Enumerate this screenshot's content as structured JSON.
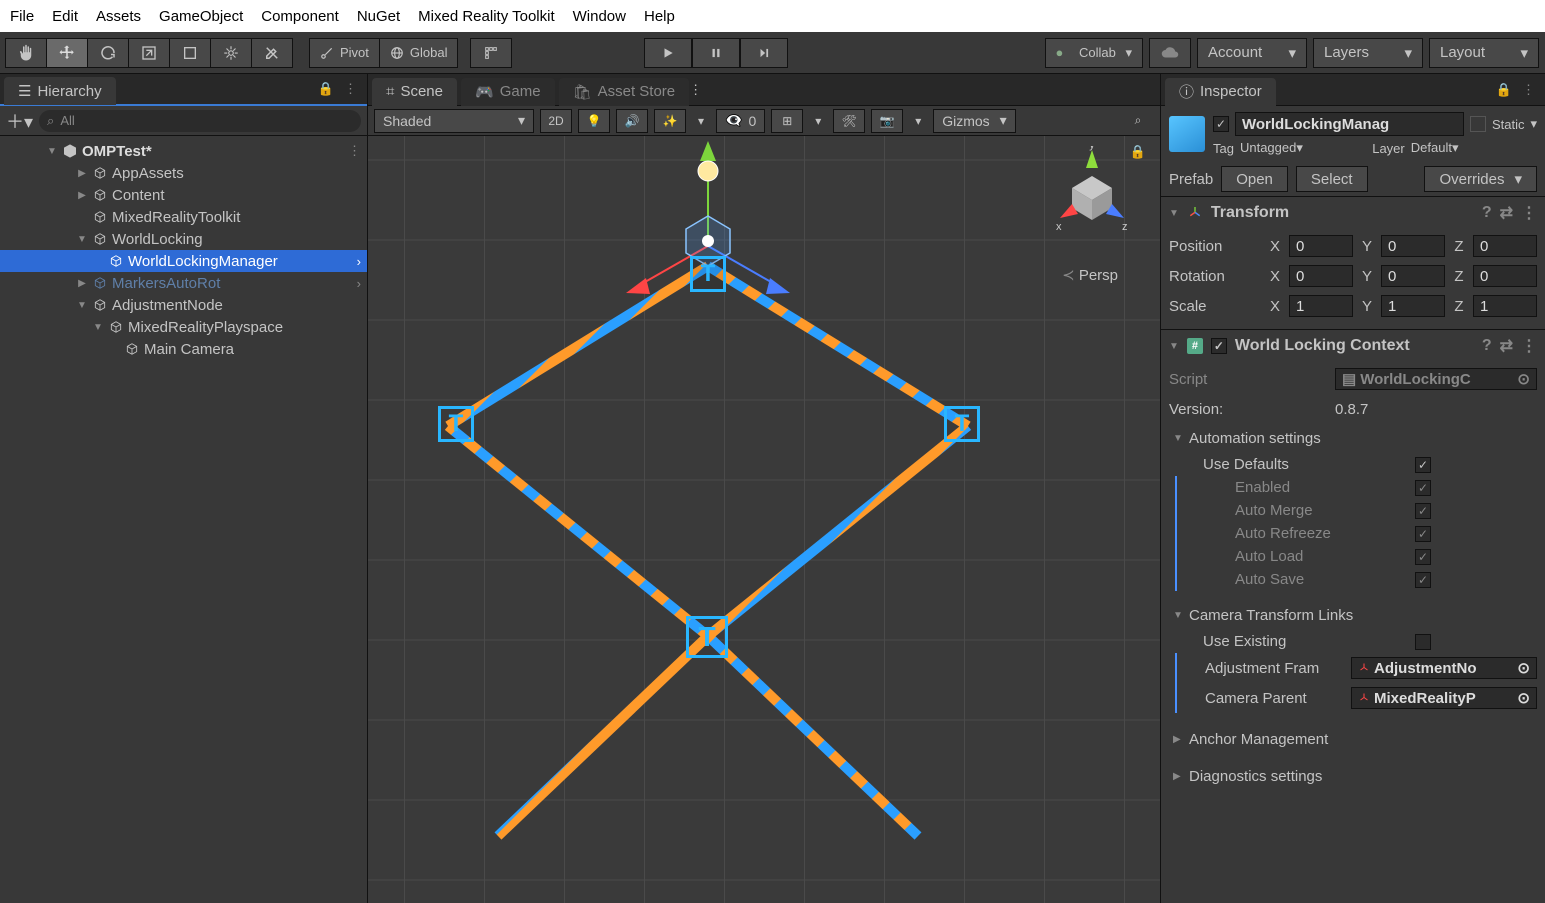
{
  "menubar": [
    "File",
    "Edit",
    "Assets",
    "GameObject",
    "Component",
    "NuGet",
    "Mixed Reality Toolkit",
    "Window",
    "Help"
  ],
  "toolbar": {
    "pivot": "Pivot",
    "global": "Global",
    "collab": "Collab",
    "account": "Account",
    "layers": "Layers",
    "layout": "Layout"
  },
  "hierarchy": {
    "title": "Hierarchy",
    "search_placeholder": "All",
    "scene": "OMPTest*",
    "items": [
      {
        "label": "AppAssets",
        "depth": 1,
        "caret": "▶",
        "type": "go"
      },
      {
        "label": "Content",
        "depth": 1,
        "caret": "▶",
        "type": "go"
      },
      {
        "label": "MixedRealityToolkit",
        "depth": 1,
        "caret": "",
        "type": "go"
      },
      {
        "label": "WorldLocking",
        "depth": 1,
        "caret": "▼",
        "type": "go"
      },
      {
        "label": "WorldLockingManager",
        "depth": 2,
        "caret": "",
        "type": "prefab",
        "selected": true,
        "arrow": true
      },
      {
        "label": "MarkersAutoRot",
        "depth": 1,
        "caret": "▶",
        "type": "prefab-muted",
        "arrow": true
      },
      {
        "label": "AdjustmentNode",
        "depth": 1,
        "caret": "▼",
        "type": "go"
      },
      {
        "label": "MixedRealityPlayspace",
        "depth": 2,
        "caret": "▼",
        "type": "go"
      },
      {
        "label": "Main Camera",
        "depth": 3,
        "caret": "",
        "type": "go"
      }
    ]
  },
  "sceneTabs": {
    "scene": "Scene",
    "game": "Game",
    "asset": "Asset Store"
  },
  "sceneToolbar": {
    "shading": "Shaded",
    "twoD": "2D",
    "hidden": "0",
    "gizmos": "Gizmos"
  },
  "viewport": {
    "persp": "Persp",
    "axes": {
      "x": "x",
      "y": "y",
      "z": "z"
    }
  },
  "inspector": {
    "title": "Inspector",
    "name": "WorldLockingManag",
    "static": "Static",
    "tagLabel": "Tag",
    "tagValue": "Untagged",
    "layerLabel": "Layer",
    "layerValue": "Default",
    "prefab": {
      "label": "Prefab",
      "open": "Open",
      "select": "Select",
      "overrides": "Overrides"
    },
    "transform": {
      "title": "Transform",
      "pos": {
        "label": "Position",
        "x": "0",
        "y": "0",
        "z": "0"
      },
      "rot": {
        "label": "Rotation",
        "x": "0",
        "y": "0",
        "z": "0"
      },
      "scl": {
        "label": "Scale",
        "x": "1",
        "y": "1",
        "z": "1"
      }
    },
    "wlc": {
      "title": "World Locking Context",
      "scriptLabel": "Script",
      "scriptValue": "WorldLockingC",
      "versionLabel": "Version:",
      "versionValue": "0.8.7",
      "autoTitle": "Automation settings",
      "useDefaults": "Use Defaults",
      "enabled": "Enabled",
      "autoMerge": "Auto Merge",
      "autoRefreeze": "Auto Refreeze",
      "autoLoad": "Auto Load",
      "autoSave": "Auto Save",
      "camLinksTitle": "Camera Transform Links",
      "useExisting": "Use Existing",
      "adjFrame": "Adjustment Fram",
      "adjFrameVal": "AdjustmentNo",
      "camParent": "Camera Parent",
      "camParentVal": "MixedRealityP",
      "anchorMgmt": "Anchor Management",
      "diag": "Diagnostics settings"
    }
  }
}
